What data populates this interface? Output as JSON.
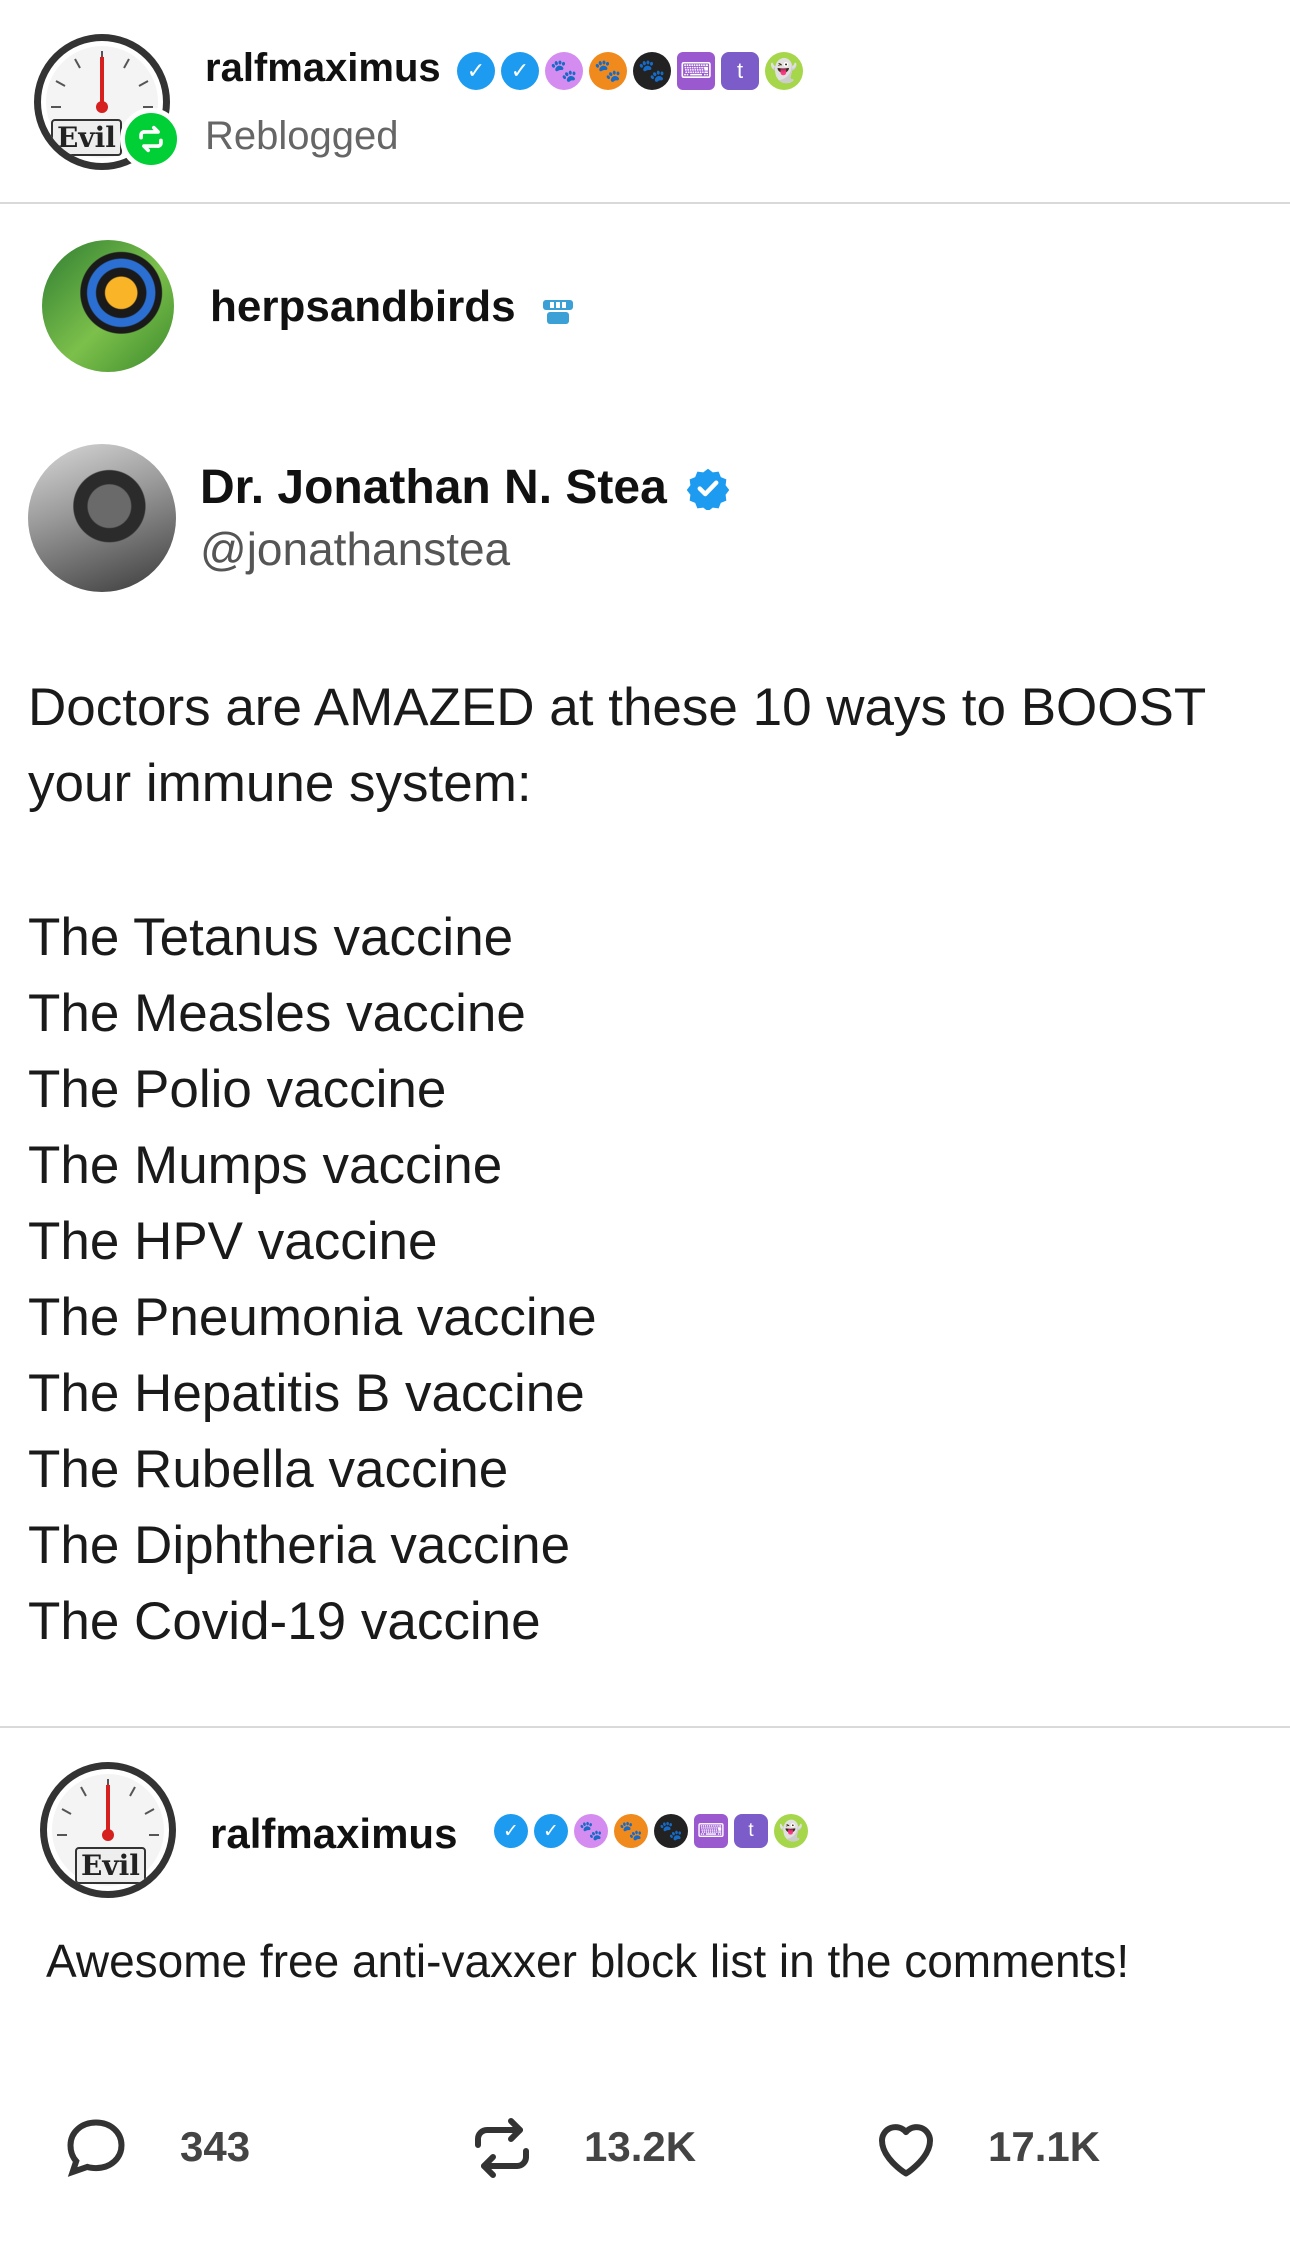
{
  "reblogger": {
    "username": "ralfmaximus",
    "status": "Reblogged",
    "avatar_text": "Evil",
    "badges": [
      "verified-icon",
      "verified-icon",
      "paw-pink-icon",
      "paw-orange-icon",
      "paw-black-icon",
      "typewriter-icon",
      "tumblr-t-icon",
      "ghost-icon"
    ]
  },
  "source_blog": {
    "username": "herpsandbirds",
    "badge": "teeth-icon"
  },
  "tweet": {
    "display_name": "Dr. Jonathan N. Stea",
    "handle": "@jonathanstea",
    "intro_line1": "Doctors are AMAZED at these 10 ways to BOOST",
    "intro_line2": "your immune system:",
    "items": [
      "The Tetanus vaccine",
      "The Measles vaccine",
      "The Polio vaccine",
      "The Mumps vaccine",
      "The HPV vaccine",
      "The Pneumonia vaccine",
      "The Hepatitis B vaccine",
      "The Rubella vaccine",
      "The Diphtheria vaccine",
      "The Covid-19 vaccine"
    ]
  },
  "reply": {
    "username": "ralfmaximus",
    "avatar_text": "Evil",
    "text": "Awesome free anti-vaxxer block list in the comments!"
  },
  "actions": {
    "comments": "343",
    "reblogs": "13.2K",
    "likes": "17.1K"
  },
  "colors": {
    "reblog_green": "#00cf35",
    "verified_blue": "#1d9bf0",
    "muted_text": "#666666",
    "divider": "#d9d9d9"
  }
}
